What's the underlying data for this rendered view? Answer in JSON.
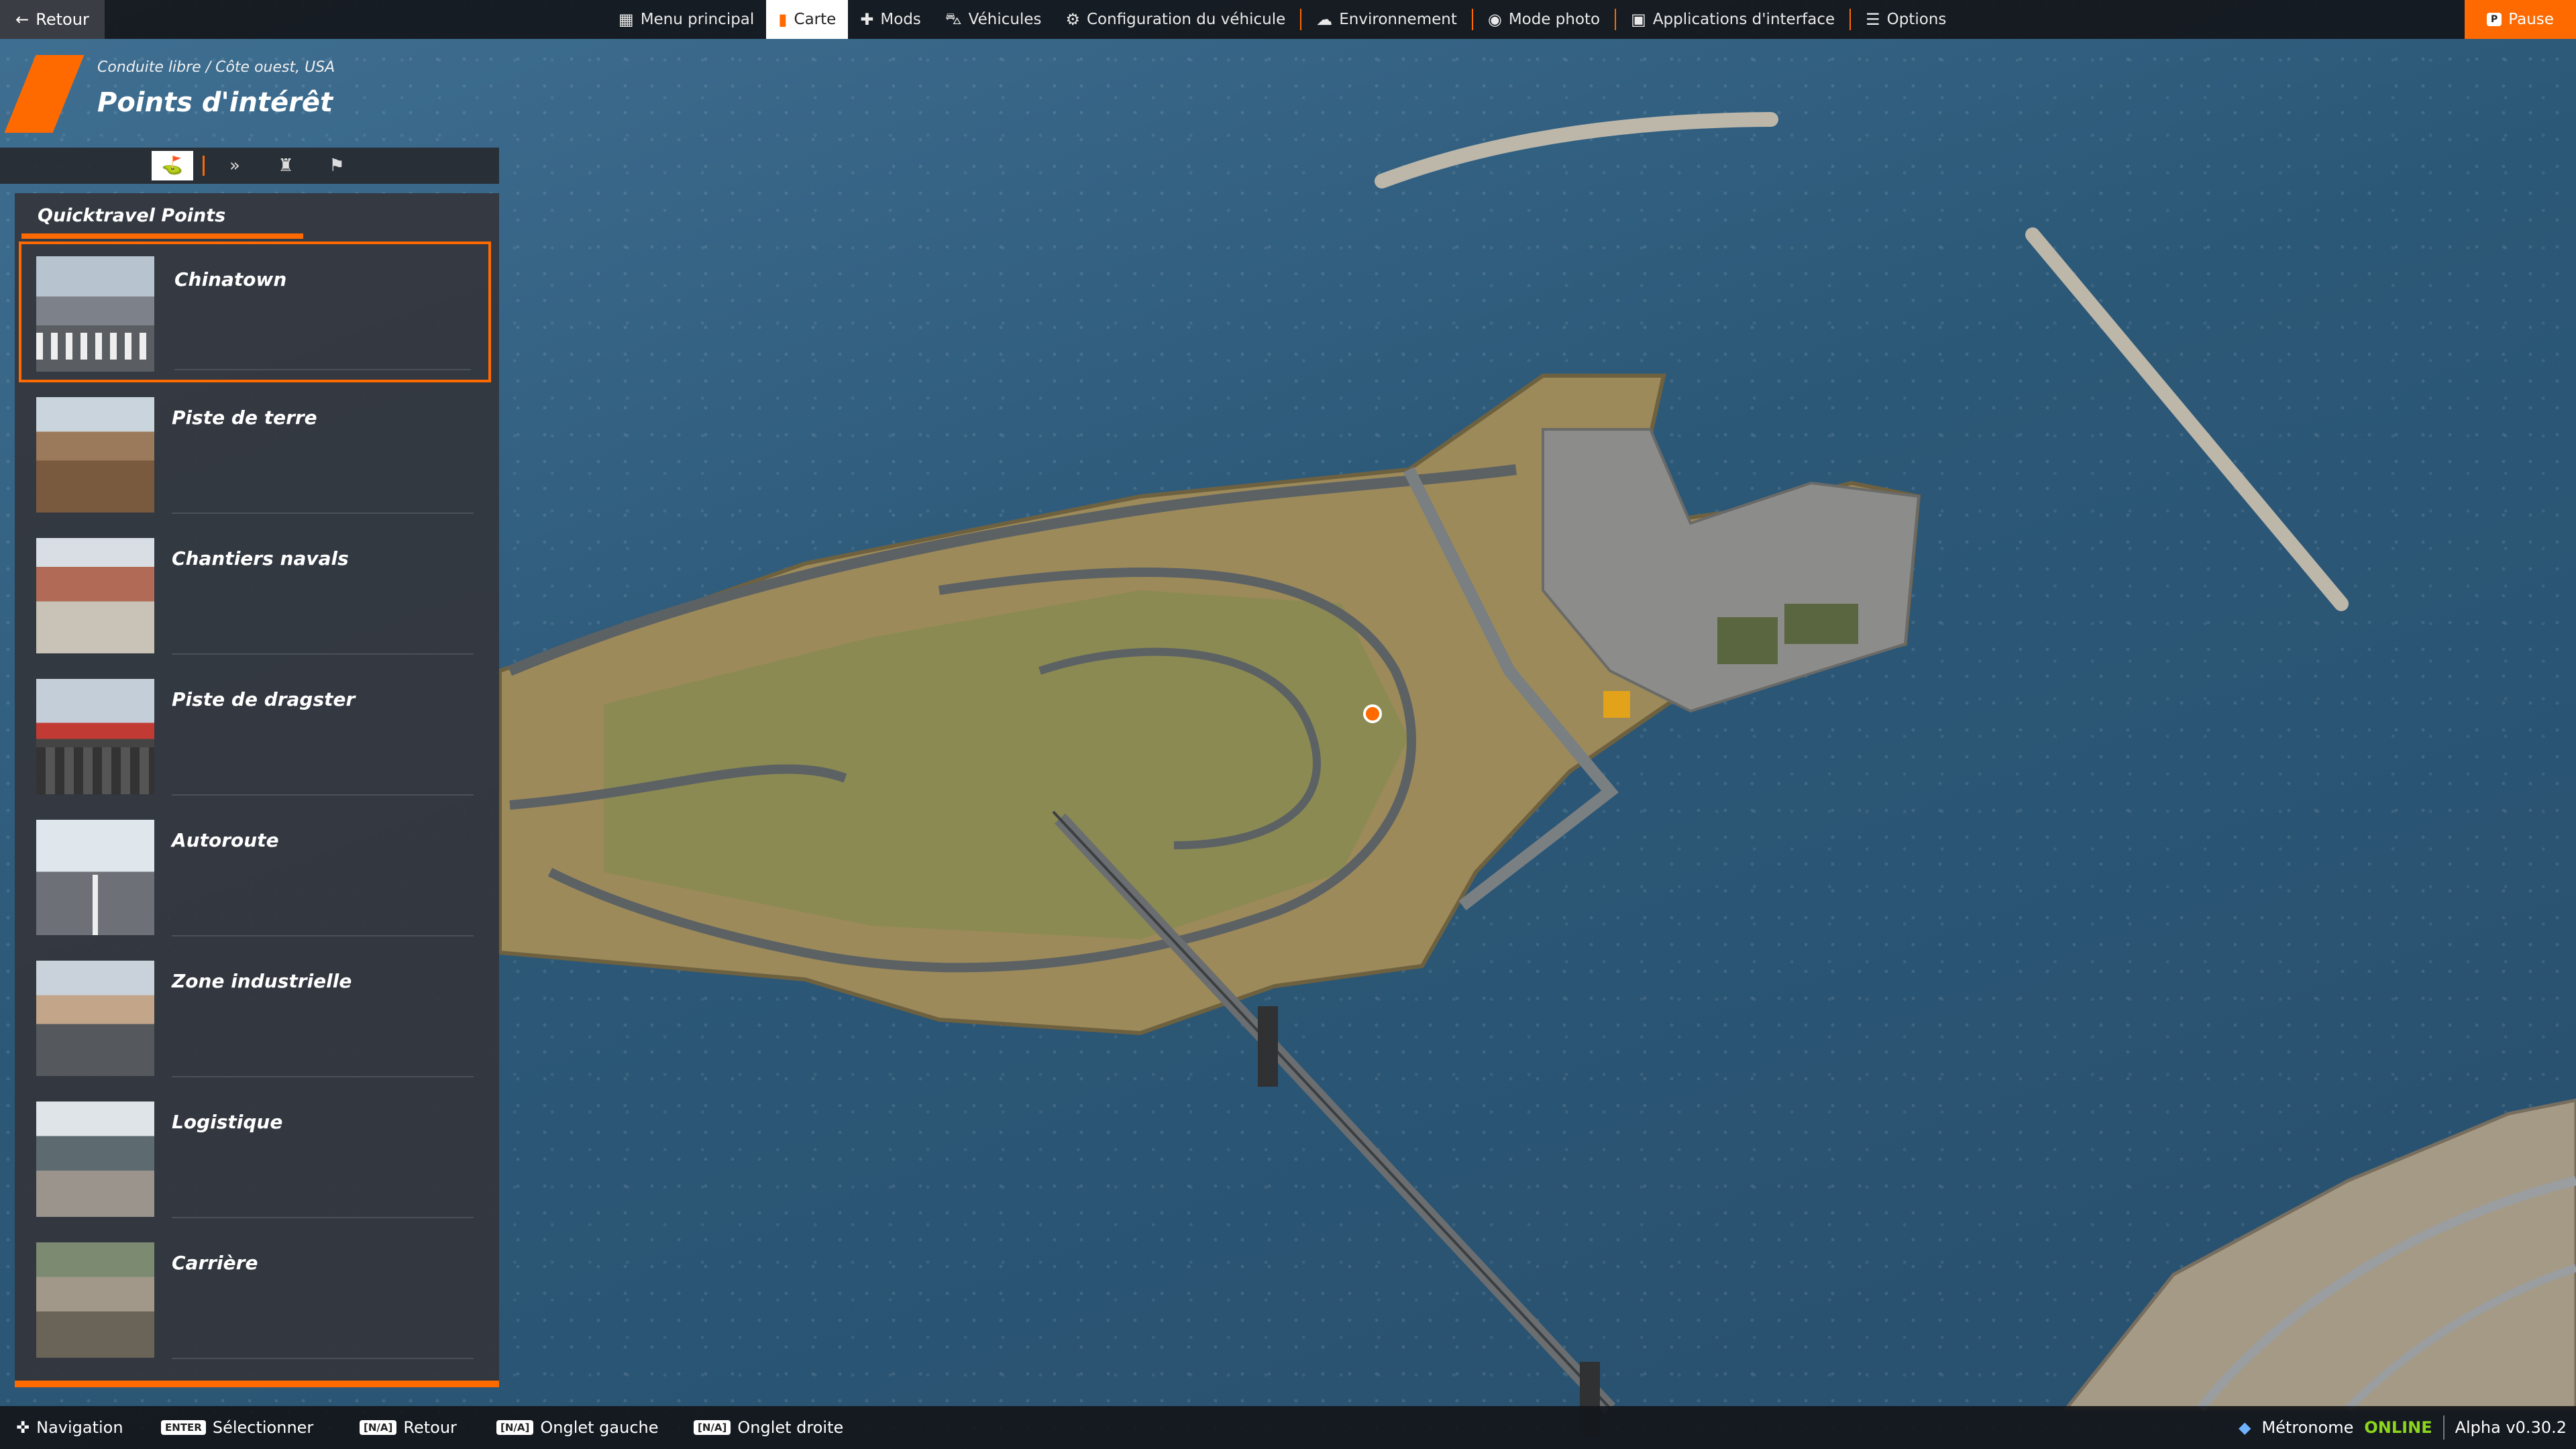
{
  "topbar": {
    "back_label": "Retour",
    "nav": [
      {
        "label": "Menu principal",
        "icon": "grid-icon"
      },
      {
        "label": "Carte",
        "icon": "map-icon",
        "active": true
      },
      {
        "label": "Mods",
        "icon": "puzzle-icon"
      },
      {
        "label": "Véhicules",
        "icon": "car-icon"
      },
      {
        "label": "Configuration du véhicule",
        "icon": "engine-icon"
      },
      {
        "label": "Environnement",
        "icon": "weather-icon"
      },
      {
        "label": "Mode photo",
        "icon": "camera-icon"
      },
      {
        "label": "Applications d'interface",
        "icon": "apps-icon"
      },
      {
        "label": "Options",
        "icon": "sliders-icon"
      }
    ],
    "pause_key": "P",
    "pause_label": "Pause"
  },
  "header": {
    "breadcrumb": "Conduite libre / Côte ouest, USA",
    "title": "Points d'intérêt"
  },
  "sidebar": {
    "tabs": [
      "poi-icon",
      "chevrons-icon",
      "trophy-icon",
      "flag-icon"
    ],
    "section_title": "Quicktravel Points",
    "items": [
      {
        "name": "Chinatown",
        "thumb": "t-city",
        "selected": true
      },
      {
        "name": "Piste de terre",
        "thumb": "t-dirt"
      },
      {
        "name": "Chantiers navals",
        "thumb": "t-dock"
      },
      {
        "name": "Piste de dragster",
        "thumb": "t-drag"
      },
      {
        "name": "Autoroute",
        "thumb": "t-highway"
      },
      {
        "name": "Zone industrielle",
        "thumb": "t-industry"
      },
      {
        "name": "Logistique",
        "thumb": "t-logistic"
      },
      {
        "name": "Carrière",
        "thumb": "t-quarry"
      }
    ]
  },
  "bottombar": {
    "hints": [
      {
        "key": "",
        "label": "Navigation"
      },
      {
        "key": "ENTER",
        "label": "Sélectionner"
      },
      {
        "key": "[N/A]",
        "label": "Retour"
      },
      {
        "key": "[N/A]",
        "label": "Onglet gauche"
      },
      {
        "key": "[N/A]",
        "label": "Onglet droite"
      }
    ],
    "service_name": "Métronome",
    "service_status": "ONLINE",
    "version": "Alpha v0.30.2"
  },
  "colors": {
    "accent": "#ff6a00",
    "online": "#8cd61c"
  }
}
